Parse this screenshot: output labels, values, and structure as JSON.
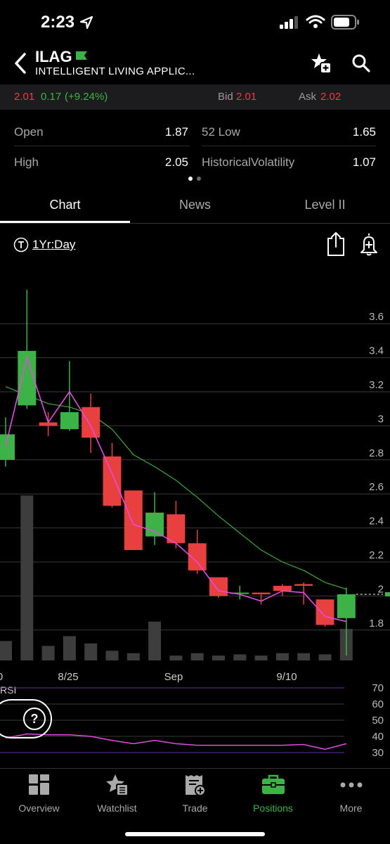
{
  "status": {
    "time": "2:23"
  },
  "header": {
    "symbol": "ILAG",
    "company": "INTELLIGENT LIVING APPLIC..."
  },
  "quote": {
    "last": "2.01",
    "change": "0.17",
    "change_pct": "(+9.24%)",
    "bid_label": "Bid",
    "bid": "2.01",
    "ask_label": "Ask",
    "ask": "2.02"
  },
  "stats": [
    {
      "label": "Open",
      "value": "1.87"
    },
    {
      "label": "52 Low",
      "value": "1.65"
    },
    {
      "label": "High",
      "value": "2.05"
    },
    {
      "label": "HistoricalVolatility",
      "value": "1.07"
    }
  ],
  "tabs": [
    {
      "label": "Chart",
      "active": true
    },
    {
      "label": "News"
    },
    {
      "label": "Level II"
    }
  ],
  "chart_controls": {
    "period": "1Yr:Day"
  },
  "chart_data": {
    "type": "candlestick",
    "y_ticks": [
      3.6,
      3.4,
      3.2,
      3,
      2.8,
      2.6,
      2.4,
      2.2,
      2,
      1.8
    ],
    "ylim": [
      1.7,
      3.7
    ],
    "x_ticks": [
      "0",
      "8/25",
      "Sep",
      "9/10"
    ],
    "candles": [
      {
        "o": 2.8,
        "h": 3.05,
        "l": 2.76,
        "c": 2.95
      },
      {
        "o": 3.12,
        "h": 3.8,
        "l": 3.1,
        "c": 3.44
      },
      {
        "o": 3.02,
        "h": 3.08,
        "l": 2.94,
        "c": 3.0
      },
      {
        "o": 2.98,
        "h": 3.38,
        "l": 2.97,
        "c": 3.08
      },
      {
        "o": 3.11,
        "h": 3.19,
        "l": 2.84,
        "c": 2.93
      },
      {
        "o": 2.82,
        "h": 2.9,
        "l": 2.52,
        "c": 2.53
      },
      {
        "o": 2.62,
        "h": 2.62,
        "l": 2.27,
        "c": 2.27
      },
      {
        "o": 2.35,
        "h": 2.61,
        "l": 2.3,
        "c": 2.49
      },
      {
        "o": 2.48,
        "h": 2.56,
        "l": 2.28,
        "c": 2.31
      },
      {
        "o": 2.31,
        "h": 2.39,
        "l": 2.13,
        "c": 2.15
      },
      {
        "o": 2.11,
        "h": 2.11,
        "l": 1.99,
        "c": 2.0
      },
      {
        "o": 2.02,
        "h": 2.06,
        "l": 1.98,
        "c": 2.02
      },
      {
        "o": 2.02,
        "h": 2.02,
        "l": 1.95,
        "c": 2.01
      },
      {
        "o": 2.06,
        "h": 2.07,
        "l": 2.0,
        "c": 2.03
      },
      {
        "o": 2.07,
        "h": 2.08,
        "l": 1.95,
        "c": 2.06
      },
      {
        "o": 1.98,
        "h": 1.98,
        "l": 1.82,
        "c": 1.83
      },
      {
        "o": 1.87,
        "h": 2.05,
        "l": 1.65,
        "c": 2.01
      }
    ],
    "ma_fast": [
      2.88,
      3.4,
      3.02,
      3.2,
      3.0,
      2.72,
      2.42,
      2.38,
      2.31,
      2.2,
      2.03,
      2.01,
      1.97,
      2.03,
      2.02,
      1.88,
      1.85
    ],
    "ma_slow": [
      3.23,
      3.18,
      3.13,
      3.11,
      3.07,
      2.98,
      2.83,
      2.76,
      2.68,
      2.58,
      2.47,
      2.37,
      2.27,
      2.2,
      2.15,
      2.08,
      2.04
    ],
    "volume": [
      0.08,
      0.68,
      0.06,
      0.1,
      0.07,
      0.04,
      0.03,
      0.16,
      0.02,
      0.03,
      0.02,
      0.025,
      0.02,
      0.03,
      0.03,
      0.025,
      0.13
    ],
    "last_price": 2.01,
    "rsi": {
      "label": "RSI",
      "levels": [
        70,
        60,
        50,
        40,
        30
      ],
      "values": [
        39,
        41.5,
        41,
        41,
        40,
        37.5,
        35.5,
        37.5,
        35.5,
        34.5,
        34.5,
        34.5,
        34.5,
        34.5,
        35,
        32,
        35.5
      ]
    }
  },
  "help_button": {
    "label": "?"
  },
  "bottom_nav": [
    {
      "label": "Overview",
      "icon": "grid-icon"
    },
    {
      "label": "Watchlist",
      "icon": "star-list-icon"
    },
    {
      "label": "Trade",
      "icon": "trade-ticket-icon"
    },
    {
      "label": "Positions",
      "icon": "briefcase-icon",
      "active": true
    },
    {
      "label": "More",
      "icon": "dots-icon"
    }
  ],
  "colors": {
    "up": "#3db246",
    "down": "#e8403f",
    "ma_fast": "#e34ce0",
    "ma_slow": "#3fa93b",
    "active_nav": "#3db246"
  }
}
